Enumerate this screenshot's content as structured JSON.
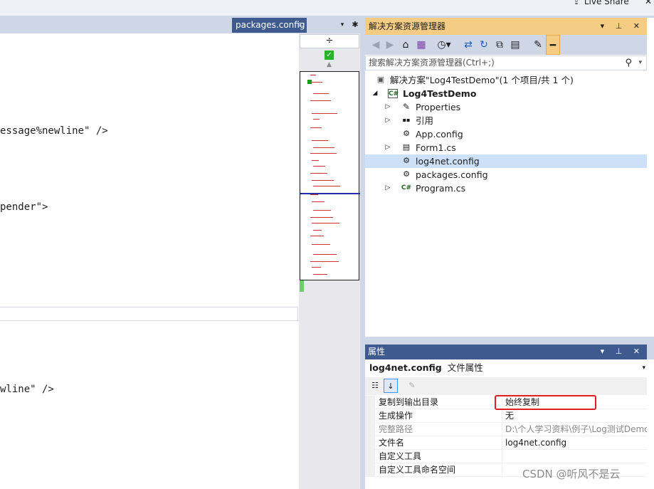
{
  "topbar": {
    "live_share": "Live Share",
    "close": "✕"
  },
  "editor": {
    "tab_label": "packages.config",
    "tab_pin": "⊏",
    "tab_dropdown": "▾",
    "tab_settings": "✱",
    "lines": [
      {
        "text": "essage%newline\" />"
      },
      {
        "text": "pender\">"
      },
      {
        "text": "wline\" />"
      }
    ]
  },
  "scrollbar": {
    "split_symbol": "÷",
    "check_symbol": "✓",
    "up_symbol": "▲"
  },
  "solution_explorer": {
    "title": "解决方案资源管理器",
    "title_buttons": "▾ ⊥ ✕",
    "search_placeholder": "搜索解决方案资源管理器(Ctrl+;)",
    "search_icon": "⚲",
    "search_dropdown": "▾",
    "toolbar_icons": [
      "back-icon",
      "forward-icon",
      "home-icon",
      "vs-icon",
      "history-icon",
      "sync-icon",
      "refresh-icon",
      "collapse-icon",
      "show-all-icon",
      "wrench-icon",
      "pin-icon"
    ],
    "tree": [
      {
        "label": "解决方案\"Log4TestDemo\"(1 个项目/共 1 个)",
        "icon": "solution-icon",
        "glyph": "▣",
        "expander": "",
        "bold": false
      },
      {
        "label": "Log4TestDemo",
        "icon": "csharp-project-icon",
        "glyph": "C#",
        "expander": "◢",
        "bold": true
      },
      {
        "label": "Properties",
        "icon": "wrench-icon",
        "glyph": "🔧",
        "expander": "▷",
        "bold": false
      },
      {
        "label": "引用",
        "icon": "references-icon",
        "glyph": "▪▪",
        "expander": "▷",
        "bold": false
      },
      {
        "label": "App.config",
        "icon": "config-file-icon",
        "glyph": "⚙",
        "expander": "",
        "bold": false
      },
      {
        "label": "Form1.cs",
        "icon": "form-icon",
        "glyph": "▤",
        "expander": "▷",
        "bold": false
      },
      {
        "label": "log4net.config",
        "icon": "config-file-icon",
        "glyph": "⚙",
        "expander": "",
        "bold": false,
        "selected": true
      },
      {
        "label": "packages.config",
        "icon": "config-file-icon",
        "glyph": "⚙",
        "expander": "",
        "bold": false
      },
      {
        "label": "Program.cs",
        "icon": "csharp-file-icon",
        "glyph": "C#",
        "expander": "▷",
        "bold": false
      }
    ]
  },
  "properties": {
    "title": "属性",
    "title_buttons": "▾ ⊥ ✕",
    "object_name": "log4net.config",
    "object_type": "文件属性",
    "object_dropdown": "▾",
    "rows": [
      {
        "name": "复制到输出目录",
        "value": "始终复制",
        "gray": false
      },
      {
        "name": "生成操作",
        "value": "无",
        "gray": false
      },
      {
        "name": "完整路径",
        "value": "D:\\个人学习资料\\例子\\Log测试Demo",
        "gray": true
      },
      {
        "name": "文件名",
        "value": "log4net.config",
        "gray": false
      },
      {
        "name": "自定义工具",
        "value": "",
        "gray": false
      },
      {
        "name": "自定义工具命名空间",
        "value": "",
        "gray": false
      }
    ]
  },
  "watermark": "CSDN @听风不是云",
  "colors": {
    "accent_title": "#f5cc84",
    "panel_title": "#3f5a8e",
    "selection": "#cce0f7",
    "highlight_box": "#e02020"
  }
}
